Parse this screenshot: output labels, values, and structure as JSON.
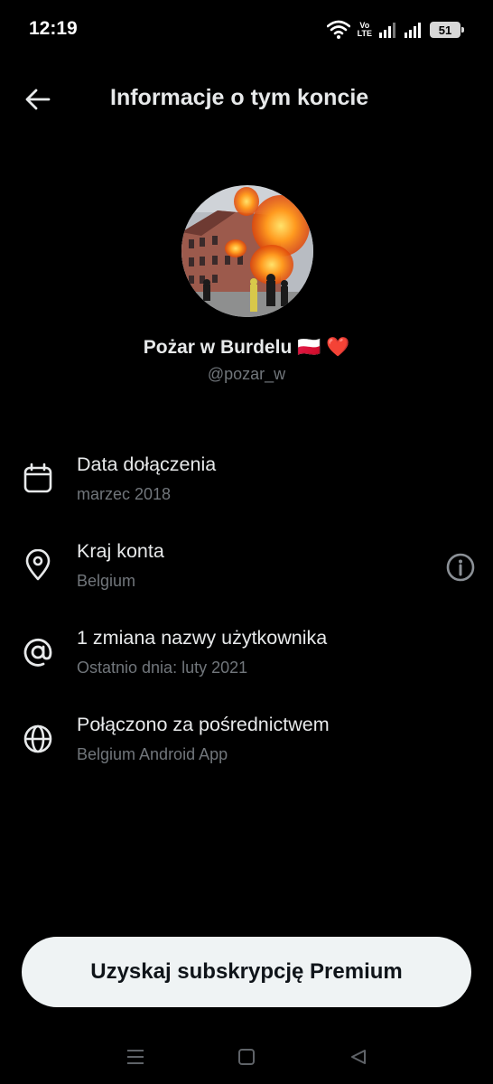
{
  "status_bar": {
    "time": "12:19",
    "network_label_top": "Vo",
    "network_label_bottom": "LTE",
    "battery": "51",
    "icons": [
      "wifi-icon",
      "volte-icon",
      "signal-icon",
      "signal-icon",
      "battery-icon"
    ]
  },
  "header": {
    "title": "Informacje o tym koncie",
    "back_icon": "arrow-left-icon"
  },
  "profile": {
    "display_name": "Pożar w Burdelu 🇵🇱 ❤️",
    "handle": "@pozar_w"
  },
  "rows": [
    {
      "icon": "calendar-icon",
      "title": "Data dołączenia",
      "subtitle": "marzec 2018"
    },
    {
      "icon": "location-pin-icon",
      "title": "Kraj konta",
      "subtitle": "Belgium",
      "trailing_icon": "info-icon"
    },
    {
      "icon": "at-sign-icon",
      "title": "1 zmiana nazwy użytkownika",
      "subtitle": "Ostatnio dnia: luty 2021"
    },
    {
      "icon": "globe-icon",
      "title": "Połączono za pośrednictwem",
      "subtitle": "Belgium Android App"
    }
  ],
  "premium_button": {
    "label": "Uzyskaj subskrypcję Premium"
  },
  "nav_bar": {
    "icons": [
      "menu-icon",
      "home-square-icon",
      "back-triangle-icon"
    ]
  },
  "colors": {
    "background": "#000000",
    "primary_text": "#e7e9ea",
    "secondary_text": "#71767b",
    "button_bg": "#eff3f4",
    "button_text": "#0f1419"
  }
}
